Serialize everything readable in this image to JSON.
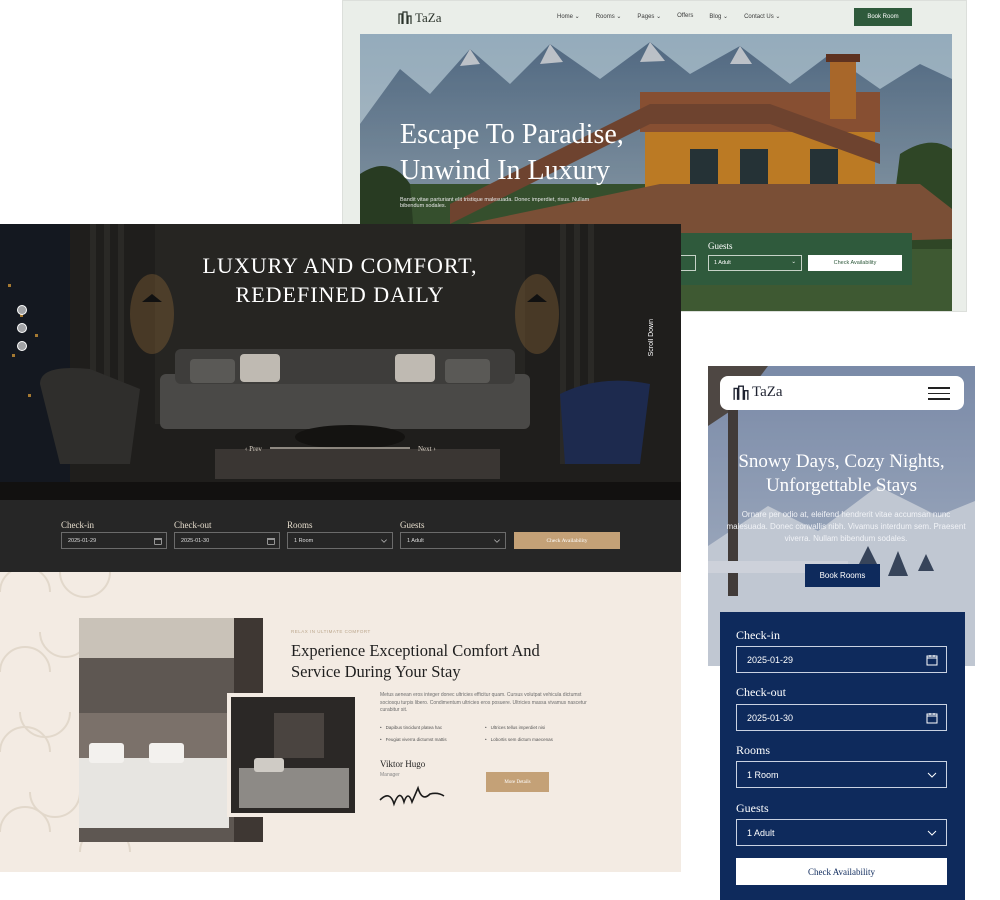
{
  "panel1": {
    "logo": "TaZa",
    "menu": [
      "Home ⌄",
      "Rooms ⌄",
      "Pages ⌄",
      "Offers",
      "Blog ⌄",
      "Contact Us ⌄"
    ],
    "book_button": "Book Room",
    "hero_title_line1": "Escape To Paradise,",
    "hero_title_line2": "Unwind In Luxury",
    "hero_text": "Bandit vitae parturiant elit tristique malesuada. Donec imperdiet, risus. Nullam bibendum sodales.",
    "booking": {
      "guests_label": "Guests",
      "guests_value": "1 Adult",
      "check_button": "Check Availability"
    },
    "accent_color": "#2f5a3c"
  },
  "panel2": {
    "title_line1": "LUXURY AND COMFORT,",
    "title_line2": "REDEFINED DAILY",
    "prev": "Prev",
    "next": "Next",
    "scroll": "Scroll Down",
    "booking": {
      "checkin_label": "Check-in",
      "checkin_value": "2025-01-29",
      "checkout_label": "Check-out",
      "checkout_value": "2025-01-30",
      "rooms_label": "Rooms",
      "rooms_value": "1 Room",
      "guests_label": "Guests",
      "guests_value": "1 Adult",
      "check_button": "Check Availability"
    },
    "accent_color": "#c4a177"
  },
  "panel3": {
    "logo": "TaZa",
    "title_line1": "Snowy Days, Cozy Nights,",
    "title_line2": "Unforgettable Stays",
    "desc": "Ornare per odio at, eleifend hendrerit vitae accumsan nunc malesuada. Donec convallis nibh. Vivamus interdum sem. Praesent viverra. Nullam bibendum sodales.",
    "book_button": "Book Rooms",
    "booking": {
      "checkin_label": "Check-in",
      "checkin_value": "2025-01-29",
      "checkout_label": "Check-out",
      "checkout_value": "2025-01-30",
      "rooms_label": "Rooms",
      "rooms_value": "1 Room",
      "guests_label": "Guests",
      "guests_value": "1 Adult",
      "check_button": "Check Availability"
    },
    "accent_color": "#0e2a5c"
  },
  "panel4": {
    "eyebrow": "RELAX IN ULTIMATE COMFORT",
    "heading_line1": "Experience Exceptional Comfort And",
    "heading_line2": "Service During Your Stay",
    "paragraph": "Metus aenean eros integer donec ultricies efficitur quam. Cursus volutpat vehicula dictumst sociosqu turpis libero. Condimentum ultricies eros posuere. Ultricies massa vivamus nascetur curabitur sit.",
    "bullets": [
      "Dapibus tincidunt platea hac",
      "Feugiat viverra dictumst mattis",
      "Ultrices tellus imperdiet nisi",
      "Lobortis sem dictum maecenas"
    ],
    "signature_name": "Viktor Hugo",
    "signature_role": "Manager",
    "more_button": "More Details"
  }
}
